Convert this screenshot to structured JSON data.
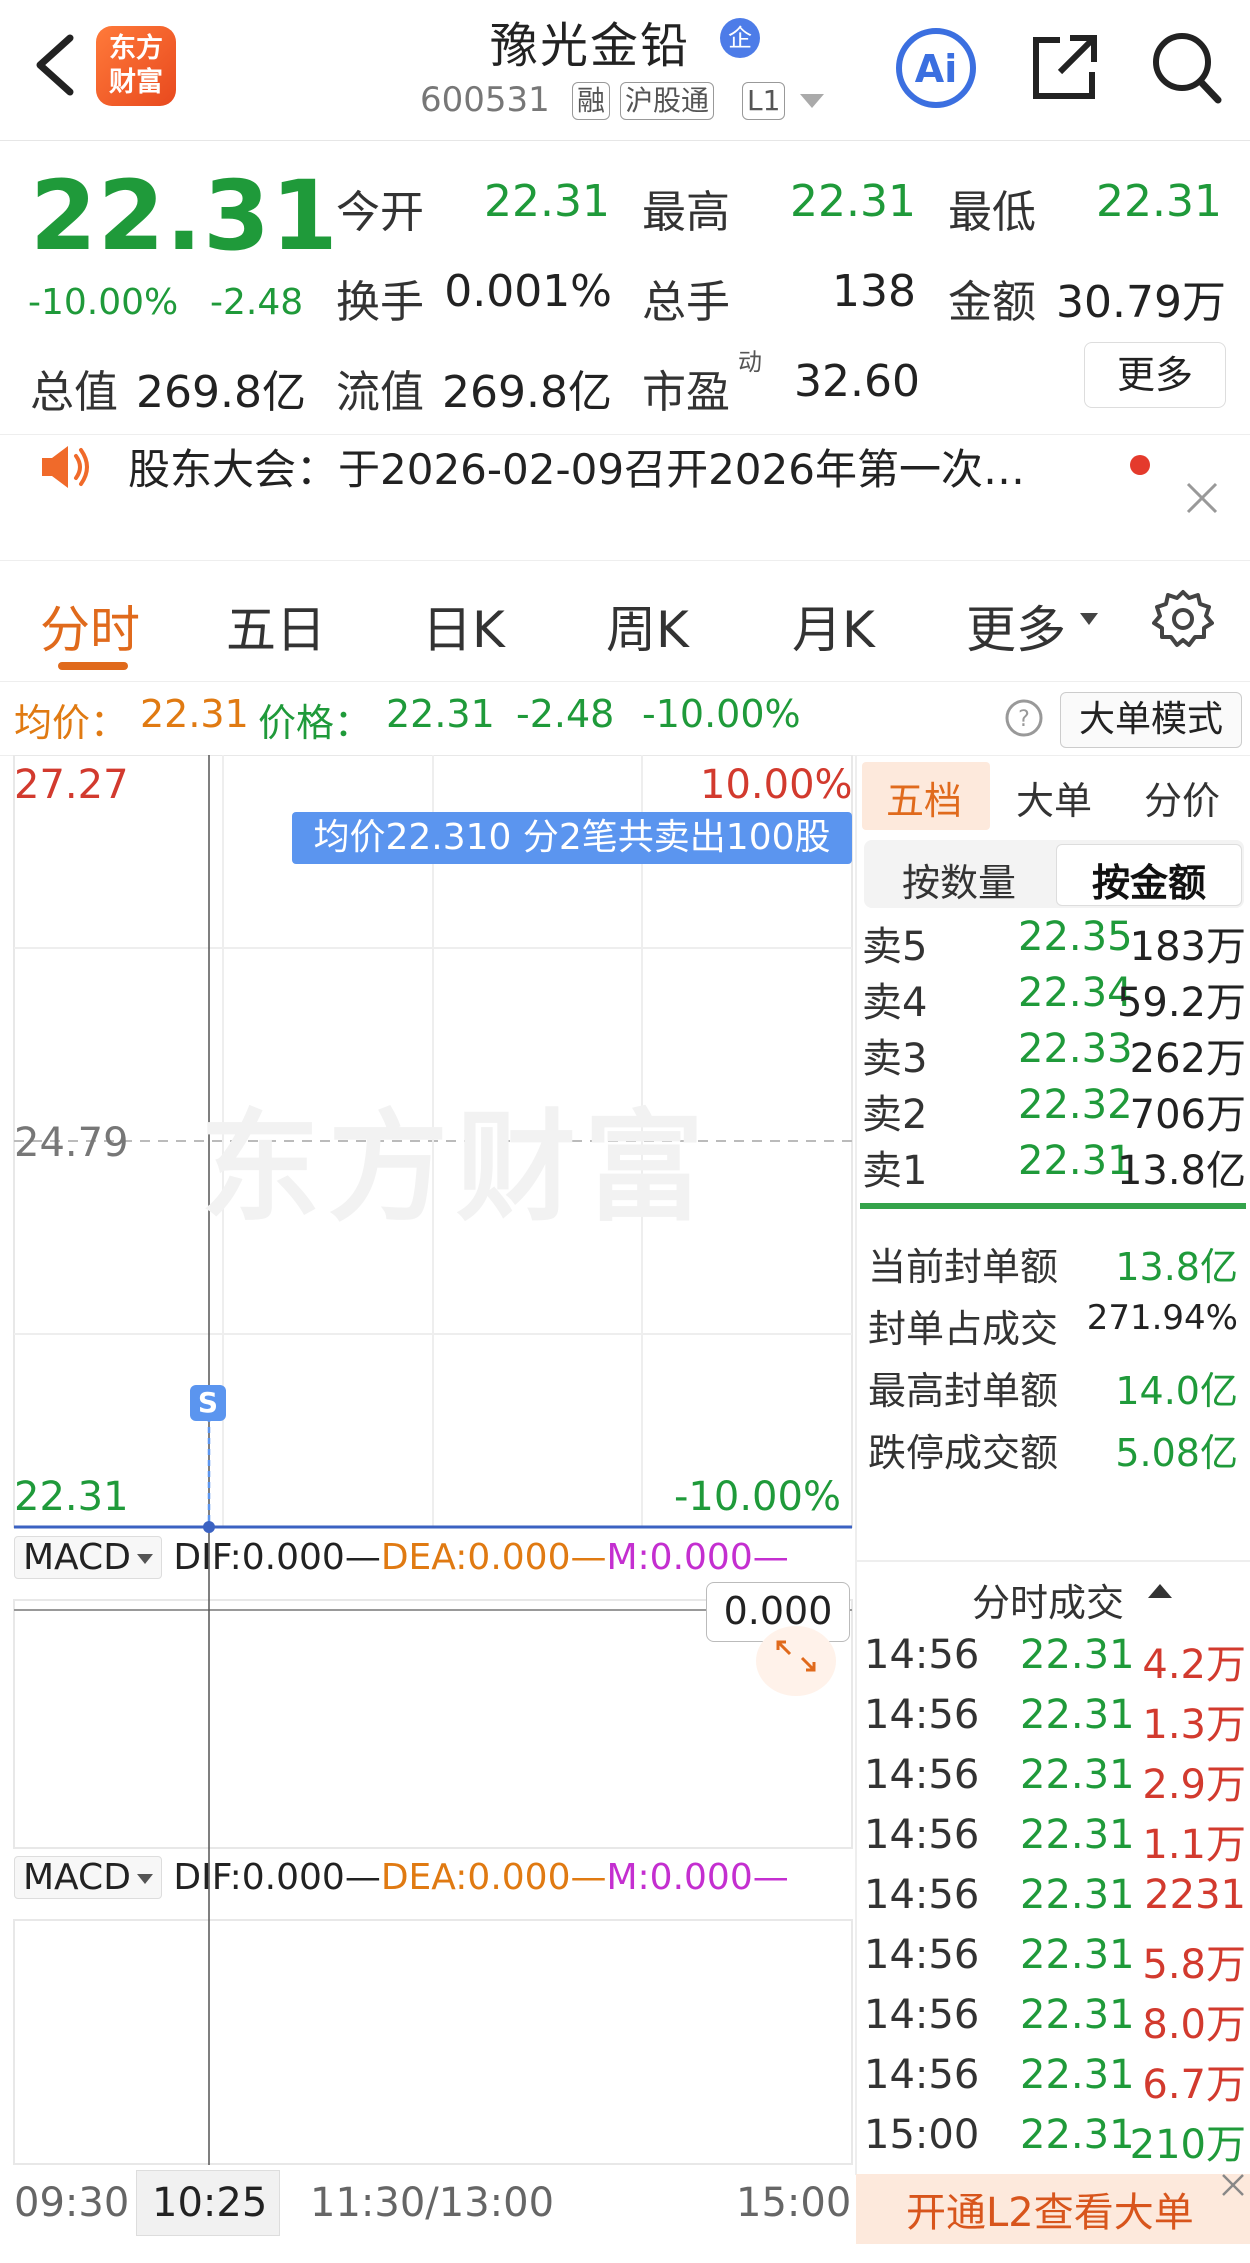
{
  "header": {
    "title": "豫光金铅",
    "badge": "企",
    "code": "600531",
    "tags": [
      "融",
      "沪股通",
      "L1"
    ],
    "logo_line1": "东方",
    "logo_line2": "财富"
  },
  "quote": {
    "price": "22.31",
    "change_pct": "-10.00%",
    "change": "-2.48",
    "fields": [
      {
        "label": "今开",
        "value": "22.31"
      },
      {
        "label": "最高",
        "value": "22.31"
      },
      {
        "label": "最低",
        "value": "22.31"
      },
      {
        "label": "换手",
        "value": "0.001%"
      },
      {
        "label": "总手",
        "value": "138"
      },
      {
        "label": "金额",
        "value": "30.79万"
      },
      {
        "label": "总值",
        "value": "269.8亿"
      },
      {
        "label": "流值",
        "value": "269.8亿"
      },
      {
        "label": "市盈",
        "value": "32.60"
      }
    ],
    "pe_sup": "动",
    "more_label": "更多"
  },
  "notice": {
    "text": "股东大会：于2026-02-09召开2026年第一次…"
  },
  "tabs": [
    "分时",
    "五日",
    "日K",
    "周K",
    "月K",
    "更多"
  ],
  "info_line": {
    "avg_label": "均价：",
    "avg_value": "22.31",
    "price_label": "价格：",
    "price_value": "22.31",
    "change": "-2.48",
    "change_pct": "-10.00%",
    "big_order_mode": "大单模式"
  },
  "chart": {
    "y_top": "27.27",
    "y_top_pct": "10.00%",
    "y_mid": "24.79",
    "y_bottom": "22.31",
    "y_bottom_pct": "-10.00%",
    "tooltip": "均价22.310  分2笔共卖出100股",
    "watermark": "东方财富",
    "marker": "S",
    "macd1": {
      "name": "MACD",
      "dif": "DIF:0.000—",
      "dea": "DEA:0.000—",
      "m": "M:0.000—"
    },
    "macd2": {
      "name": "MACD",
      "dif": "DIF:0.000—",
      "dea": "DEA:0.000—",
      "m": "M:0.000—"
    },
    "macd_value": "0.000",
    "time_axis": [
      "09:30",
      "10:25",
      "11:30/13:00",
      "15:00"
    ]
  },
  "chart_data": {
    "type": "line",
    "x": [
      "09:30",
      "10:25"
    ],
    "series": [
      {
        "values": [
          22.31,
          22.31
        ]
      }
    ],
    "ylim": [
      22.31,
      27.27
    ],
    "reference_price": 24.79
  },
  "right_panel": {
    "tabs": [
      "五档",
      "大单",
      "分价"
    ],
    "segments": [
      "按数量",
      "按金额"
    ],
    "order_book": [
      {
        "label": "卖5",
        "price": "22.35",
        "amount": "183万"
      },
      {
        "label": "卖4",
        "price": "22.34",
        "amount": "59.2万"
      },
      {
        "label": "卖3",
        "price": "22.33",
        "amount": "262万"
      },
      {
        "label": "卖2",
        "price": "22.32",
        "amount": "706万"
      },
      {
        "label": "卖1",
        "price": "22.31",
        "amount": "13.8亿"
      }
    ],
    "seal": [
      {
        "label": "当前封单额",
        "value": "13.8亿"
      },
      {
        "label": "封单占成交",
        "value": "271.94%"
      },
      {
        "label": "最高封单额",
        "value": "14.0亿"
      },
      {
        "label": "跌停成交额",
        "value": "5.08亿"
      }
    ],
    "trades_title": "分时成交",
    "trades": [
      {
        "time": "14:56",
        "price": "22.31",
        "vol": "4.2万"
      },
      {
        "time": "14:56",
        "price": "22.31",
        "vol": "1.3万"
      },
      {
        "time": "14:56",
        "price": "22.31",
        "vol": "2.9万"
      },
      {
        "time": "14:56",
        "price": "22.31",
        "vol": "1.1万"
      },
      {
        "time": "14:56",
        "price": "22.31",
        "vol": "2231"
      },
      {
        "time": "14:56",
        "price": "22.31",
        "vol": "5.8万"
      },
      {
        "time": "14:56",
        "price": "22.31",
        "vol": "8.0万"
      },
      {
        "time": "14:56",
        "price": "22.31",
        "vol": "6.7万"
      },
      {
        "time": "15:00",
        "price": "22.31",
        "vol": "210万"
      }
    ],
    "l2_banner": "开通L2查看大单"
  },
  "colors": {
    "down": "#1f9a3a",
    "up": "#d23a2e",
    "accent": "#e06a1c",
    "avg": "#e07a12",
    "m_line": "#c42fd0",
    "tooltip_bg": "#5b95ef"
  }
}
